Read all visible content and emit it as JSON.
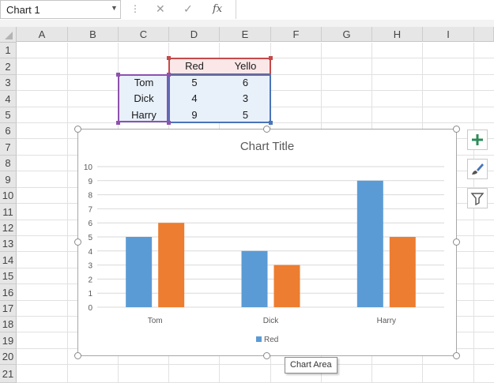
{
  "name_box": {
    "value": "Chart 1"
  },
  "formula_bar": {
    "cancel_icon": "x-icon",
    "enter_icon": "check-icon",
    "function_label": "fx",
    "value": ""
  },
  "columns": [
    "A",
    "B",
    "C",
    "D",
    "E",
    "F",
    "G",
    "H",
    "I"
  ],
  "rows": [
    "1",
    "2",
    "3",
    "4",
    "5",
    "6",
    "7",
    "8",
    "9",
    "10",
    "11",
    "12",
    "13",
    "14",
    "15",
    "16",
    "17",
    "18",
    "19",
    "20",
    "21"
  ],
  "sheet": {
    "header_row": [
      "Red",
      "Yello"
    ],
    "data_rows": [
      {
        "label": "Tom",
        "values": [
          "5",
          "6"
        ]
      },
      {
        "label": "Dick",
        "values": [
          "4",
          "3"
        ]
      },
      {
        "label": "Harry",
        "values": [
          "9",
          "5"
        ]
      }
    ]
  },
  "chart_data": {
    "type": "bar",
    "title": "Chart Title",
    "categories": [
      "Tom",
      "Dick",
      "Harry"
    ],
    "series": [
      {
        "name": "Red",
        "values": [
          5,
          4,
          9
        ],
        "color": "#5b9bd5"
      },
      {
        "values": [
          6,
          3,
          5
        ],
        "color": "#ed7d31"
      }
    ],
    "ylim": [
      0,
      10
    ],
    "yticks": [
      0,
      1,
      2,
      3,
      4,
      5,
      6,
      7,
      8,
      9,
      10
    ],
    "grid": true,
    "legend": "bottom"
  },
  "chart_buttons": [
    {
      "name": "chart-elements-button",
      "icon": "plus-icon"
    },
    {
      "name": "chart-styles-button",
      "icon": "paintbrush-icon"
    },
    {
      "name": "chart-filters-button",
      "icon": "filter-icon"
    }
  ],
  "tooltip": {
    "text": "Chart Area"
  },
  "colors": {
    "accent_green": "#2e8b57",
    "red_series": "#5b9bd5",
    "orange_series": "#ed7d31"
  }
}
